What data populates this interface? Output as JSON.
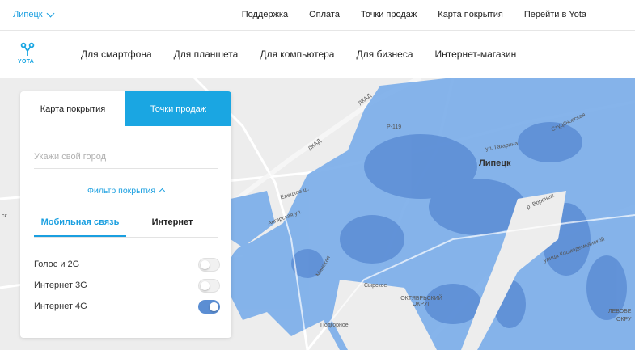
{
  "topbar": {
    "city": "Липецк",
    "links": [
      "Поддержка",
      "Оплата",
      "Точки продаж",
      "Карта покрытия",
      "Перейти в Yota"
    ]
  },
  "logo": {
    "text": "YOTA"
  },
  "nav": {
    "items": [
      "Для смартфона",
      "Для планшета",
      "Для компьютера",
      "Для бизнеса",
      "Интернет-магазин"
    ]
  },
  "panel": {
    "tabs": [
      "Карта покрытия",
      "Точки продаж"
    ],
    "active_tab": "Точки продаж",
    "city_input": {
      "placeholder": "Укажи свой город",
      "value": ""
    },
    "filter_label": "Фильтр покрытия",
    "subtabs": [
      "Мобильная связь",
      "Интернет"
    ],
    "active_subtab": "Мобильная связь",
    "options": [
      {
        "label": "Голос и 2G",
        "enabled": false
      },
      {
        "label": "Интернет 3G",
        "enabled": false
      },
      {
        "label": "Интернет 4G",
        "enabled": true
      }
    ]
  },
  "map": {
    "labels": {
      "city": "Липецк",
      "lkad1": "ЛКАД",
      "lkad2": "ЛКАД",
      "road1": "Р-119",
      "district1": "Сырское",
      "district2": "ОКТЯБРЬСКИЙ ОКРУГ",
      "district3": "Подгорное",
      "street1": "ул. Гагарина",
      "street2": "Студёновская",
      "street3": "улица Космодемьянской",
      "street4": "р. Воронеж",
      "street5": "Минская",
      "street6": "Елецкое ш.",
      "street7": "Ангарская ул.",
      "edge1": "ЛЕВОБЕ",
      "edge2": "ОКРУ",
      "edge3": "ск"
    },
    "colors": {
      "background": "#ededed",
      "coverage": "#7fb0ea",
      "coverage_dense": "#5e8fd6",
      "roads": "#ffffff"
    }
  },
  "accent": "#1aa6e2"
}
